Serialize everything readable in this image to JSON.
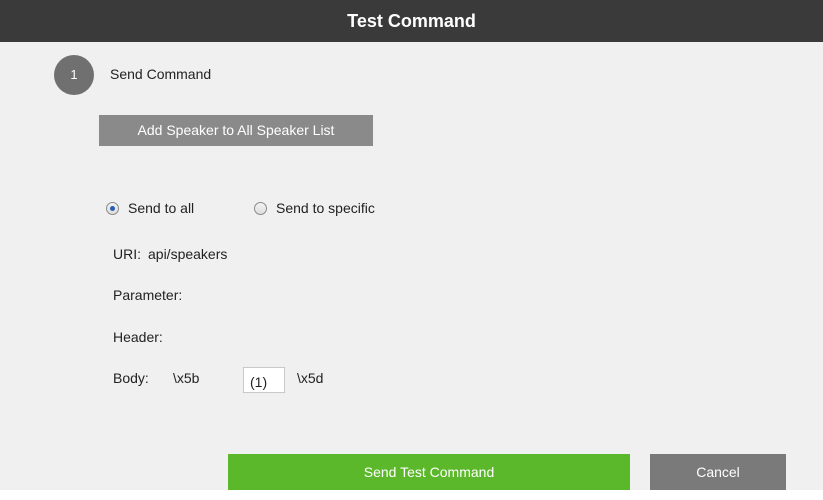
{
  "dialog": {
    "title": "Test Command"
  },
  "step": {
    "number": "1",
    "label": "Send Command"
  },
  "add_speaker_button": "Add Speaker to All Speaker List",
  "target": {
    "options": [
      {
        "label": "Send to all",
        "selected": true
      },
      {
        "label": "Send to specific",
        "selected": false
      }
    ]
  },
  "fields": {
    "uri_label": "URI:",
    "uri_value": "api/speakers",
    "parameter_label": "Parameter:",
    "header_label": "Header:",
    "body_label": "Body:",
    "body_prefix": "\\x5b",
    "body_input_value": "(1)",
    "body_suffix": "\\x5d"
  },
  "actions": {
    "send_label": "Send Test Command",
    "cancel_label": "Cancel"
  },
  "colors": {
    "titlebar": "#3a3a3a",
    "panel": "#f0f0f0",
    "send_button": "#5cb82b",
    "cancel_button": "#7a7a7a",
    "secondary_button": "#8a8a8a",
    "step_circle": "#707070"
  }
}
